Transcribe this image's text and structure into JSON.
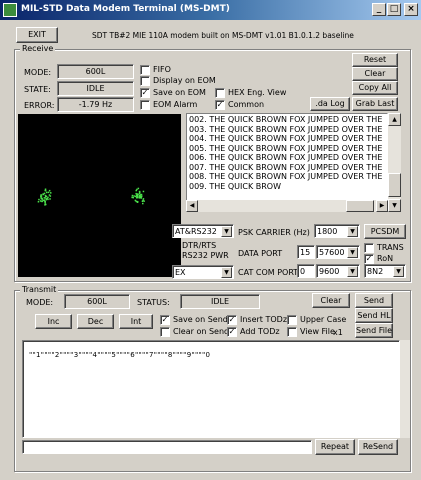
{
  "window": {
    "title": "MIL-STD Data Modem Terminal (MS-DMT)",
    "min_label": "_",
    "max_label": "□",
    "close_label": "×"
  },
  "toolbar": {
    "exit_label": "EXIT",
    "version_text": "SDT TB#2 MIE 110A modem built on MS-DMT v1.01 B1.0.1.2 baseline"
  },
  "receive": {
    "group_label": "Receive",
    "mode_label": "MODE:",
    "mode_value": "600L",
    "state_label": "STATE:",
    "state_value": "IDLE",
    "error_label": "ERROR:",
    "error_value": "-1.79 Hz",
    "checkboxes": [
      {
        "label": "FIFO",
        "checked": false
      },
      {
        "label": "Display on EOM",
        "checked": false
      },
      {
        "label": "Save on EOM",
        "checked": true
      },
      {
        "label": "EOM Alarm",
        "checked": false
      },
      {
        "label": "HEX Eng. View",
        "checked": false
      },
      {
        "label": "Common",
        "checked": true
      }
    ],
    "buttons": {
      "reset": "Reset",
      "clear": "Clear",
      "copy_all": "Copy All",
      "da_log": ".da Log",
      "grab_last": "Grab Last"
    },
    "log_lines": [
      "002. THE QUICK BROWN FOX JUMPED OVER THE",
      "003. THE QUICK BROWN FOX JUMPED OVER THE",
      "004. THE QUICK BROWN FOX JUMPED OVER THE",
      "005. THE QUICK BROWN FOX JUMPED OVER THE",
      "006. THE QUICK BROWN FOX JUMPED OVER THE",
      "007. THE QUICK BROWN FOX JUMPED OVER THE",
      "008. THE QUICK BROWN FOX JUMPED OVER THE",
      "009. THE QUICK BROW"
    ]
  },
  "settings": {
    "serial_combo": "AT&RS232",
    "dtr_label": "DTR/RTS",
    "rs232_label": "RS232 PWR",
    "hex_combo": "EX",
    "psk_label": "PSK CARRIER (Hz)",
    "psk_value": "1800",
    "pcsdm_label": "PCSDM",
    "data_port_label": "DATA PORT",
    "data_port_value": "15",
    "baud_value": "57600",
    "trans_label": "TRANS",
    "ron_label": "RoN",
    "ron_checked": true,
    "cat_label": "CAT COM PORT",
    "cat_value": "0",
    "cat_baud": "9600",
    "parity": "8N2"
  },
  "transmit": {
    "group_label": "Transmit",
    "mode_label": "MODE:",
    "mode_value": "600L",
    "status_label": "STATUS:",
    "status_value": "IDLE",
    "inc": "Inc",
    "dec": "Dec",
    "int": "Int",
    "checkboxes": [
      {
        "label": "Save on Send",
        "checked": true
      },
      {
        "label": "Clear on Send",
        "checked": false
      },
      {
        "label": "Insert TODz",
        "checked": true
      },
      {
        "label": "Add TODz",
        "checked": true
      },
      {
        "label": "Upper Case",
        "checked": false
      },
      {
        "label": "View File",
        "checked": false
      }
    ],
    "x1_label": "x1",
    "clear": "Clear",
    "send": "Send",
    "send_hl": "Send HL",
    "send_file": "Send File",
    "ruler": "\"\"1\"\"\"\"2\"\"\"\"3\"\"\"\"4\"\"\"\"5\"\"\"\"6\"\"\"\"7\"\"\"\"8\"\"\"\"9\"\"\"\"0",
    "repeat": "Repeat",
    "resend": "ReSend"
  }
}
